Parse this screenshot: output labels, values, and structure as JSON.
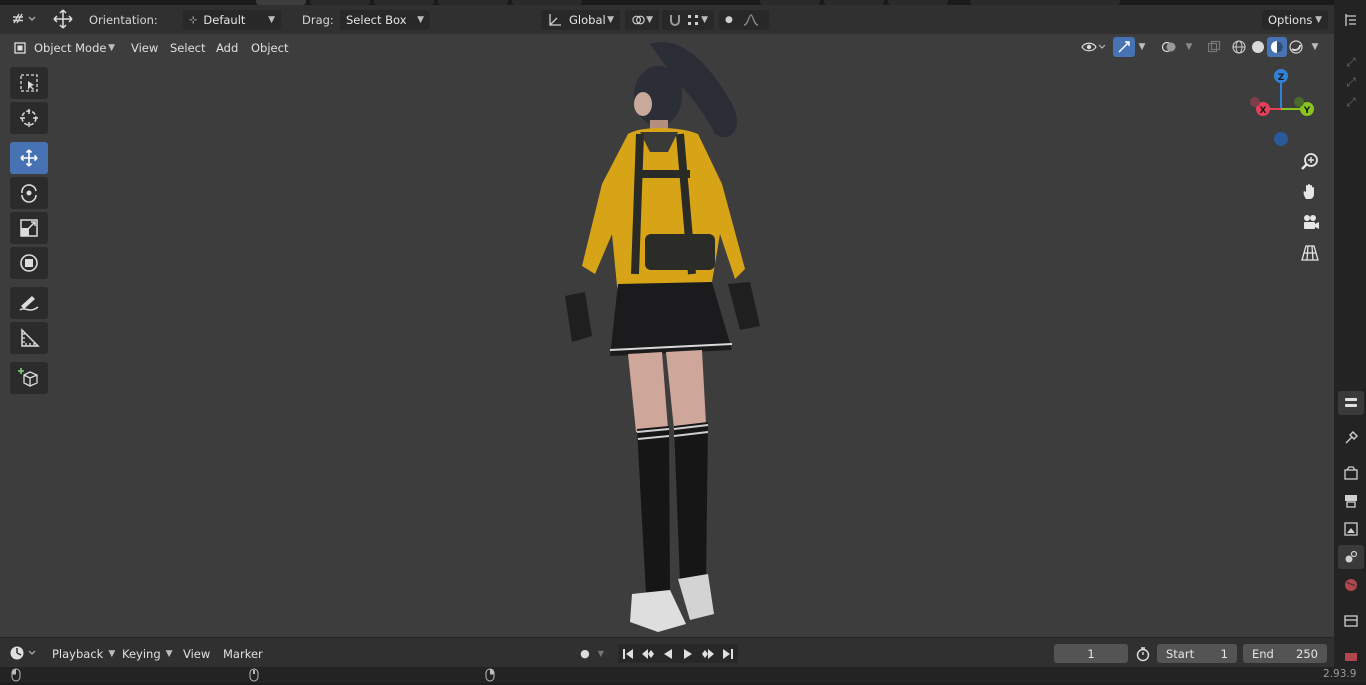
{
  "header": {
    "orientation_label": "Orientation:",
    "orientation_value": "Default",
    "drag_label": "Drag:",
    "drag_value": "Select Box",
    "transform_space": "Global",
    "options_label": "Options"
  },
  "viewport_header": {
    "mode": "Object Mode",
    "menus": [
      "View",
      "Select",
      "Add",
      "Object"
    ]
  },
  "toolshelf": {
    "tools": [
      "select-box-icon",
      "cursor-icon",
      "move-icon",
      "rotate-icon",
      "scale-icon",
      "transform-icon",
      "annotate-icon",
      "measure-icon",
      "add-cube-icon"
    ],
    "active_tool": "move-icon"
  },
  "gizmo": {
    "z": "Z",
    "y": "Y",
    "x": "X"
  },
  "timeline": {
    "menus": [
      "Playback",
      "Keying",
      "View",
      "Marker"
    ],
    "current_frame": "1",
    "start_label": "Start",
    "start_value": "1",
    "end_label": "End",
    "end_value": "250"
  },
  "status": {
    "version": "2.93.9"
  },
  "colors": {
    "accent": "#4772b3",
    "axis_x": "#e5405a",
    "axis_y": "#8ac41f",
    "axis_z": "#2f82d6",
    "viewport_bg": "#3d3d3d"
  }
}
